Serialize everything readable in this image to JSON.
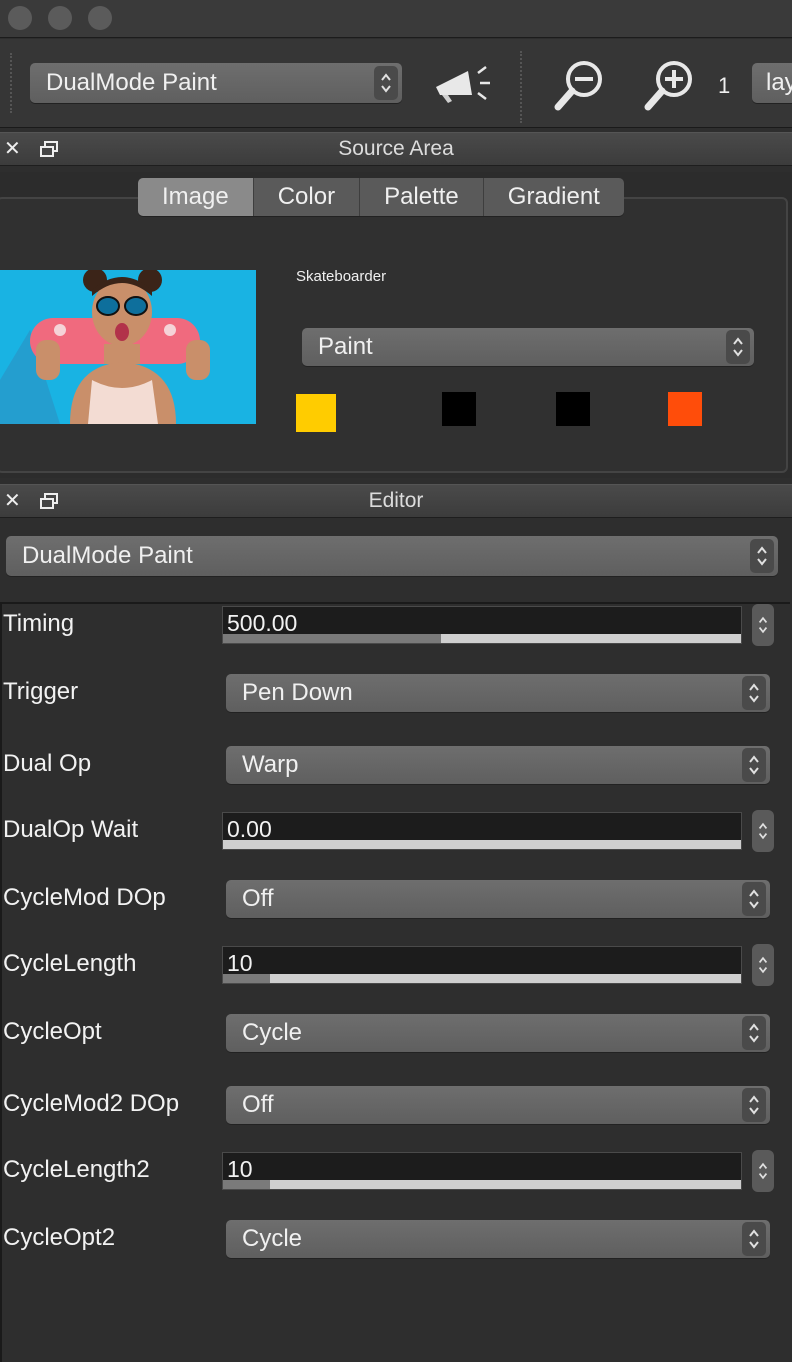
{
  "toolbar": {
    "brush_select": "DualMode Paint",
    "zoom_level": "1",
    "layer_select": "lay"
  },
  "source_area": {
    "title": "Source Area",
    "tabs": [
      "Image",
      "Color",
      "Palette",
      "Gradient"
    ],
    "active_tab": "Image",
    "image_name": "Skateboarder",
    "mode_select": "Paint",
    "swatches": [
      "#ffcc00",
      "#000000",
      "#000000",
      "#ff4d0a"
    ]
  },
  "editor": {
    "title": "Editor",
    "preset_select": "DualMode Paint",
    "rows": [
      {
        "label": "Timing",
        "type": "number",
        "value": "500.00",
        "level": 0.42
      },
      {
        "label": "Trigger",
        "type": "select",
        "value": "Pen Down"
      },
      {
        "label": "Dual Op",
        "type": "select",
        "value": "Warp"
      },
      {
        "label": "DualOp Wait",
        "type": "number",
        "value": "0.00",
        "level": 0
      },
      {
        "label": "CycleMod DOp",
        "type": "select",
        "value": "Off"
      },
      {
        "label": "CycleLength",
        "type": "number",
        "value": "10",
        "level": 0.09
      },
      {
        "label": "CycleOpt",
        "type": "select",
        "value": "Cycle"
      },
      {
        "label": "CycleMod2 DOp",
        "type": "select",
        "value": "Off"
      },
      {
        "label": "CycleLength2",
        "type": "number",
        "value": "10",
        "level": 0.09
      },
      {
        "label": "CycleOpt2",
        "type": "select",
        "value": "Cycle"
      }
    ]
  }
}
